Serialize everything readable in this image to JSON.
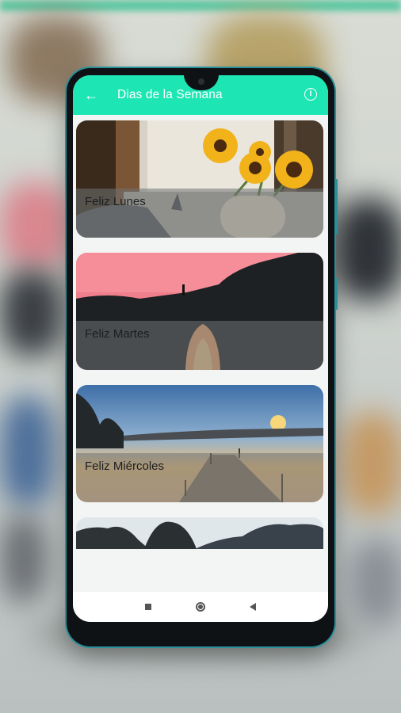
{
  "appbar": {
    "title": "Dias de la Semana",
    "back_icon": "arrow-left-icon",
    "info_icon": "info-icon",
    "color": "#1de6b4"
  },
  "cards": [
    {
      "label": "Feliz Lunes",
      "image": "sunflowers-window-cat"
    },
    {
      "label": "Feliz Martes",
      "image": "pink-sunset-cliff-arch"
    },
    {
      "label": "Feliz Miércoles",
      "image": "lake-pier-sunset"
    },
    {
      "label": "",
      "image": "misty-mountains"
    }
  ],
  "navbar": {
    "icons": [
      "square-icon",
      "circle-home-icon",
      "triangle-back-icon"
    ]
  }
}
